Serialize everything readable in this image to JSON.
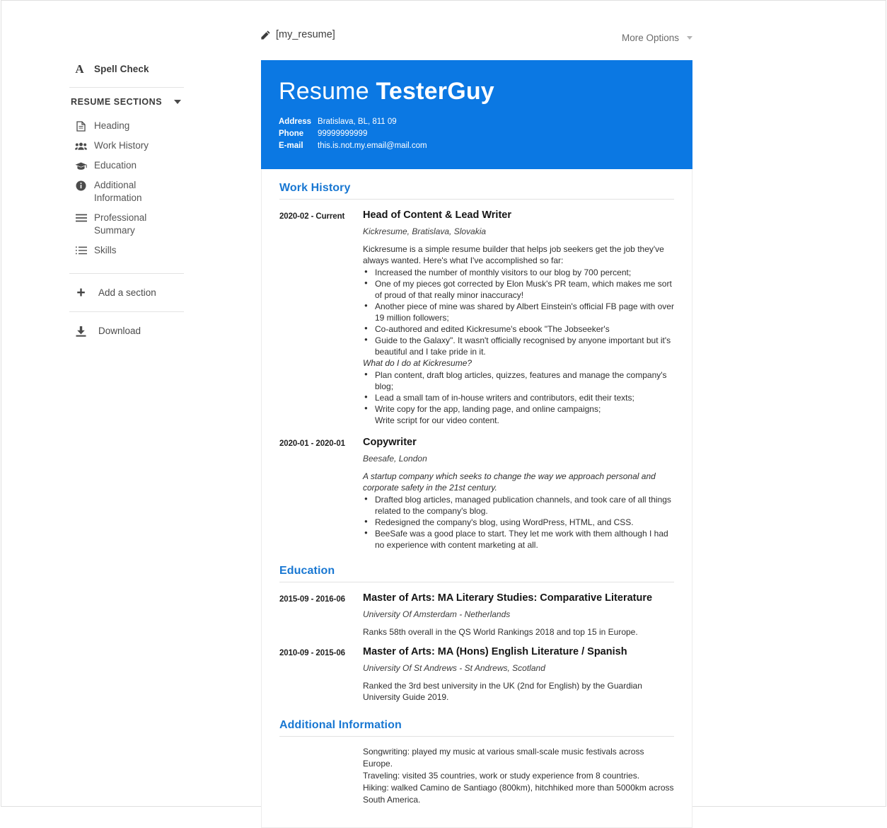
{
  "topbar": {
    "doc_name": "[my_resume]",
    "more_options": "More Options"
  },
  "sidebar": {
    "spell_check": "Spell Check",
    "sections_title": "RESUME SECTIONS",
    "items": [
      {
        "label": "Heading",
        "icon": "document-icon"
      },
      {
        "label": "Work History",
        "icon": "users-icon"
      },
      {
        "label": "Education",
        "icon": "graduation-cap-icon"
      },
      {
        "label": "Additional Information",
        "icon": "info-circle-icon"
      },
      {
        "label": "Professional Summary",
        "icon": "menu-lines-icon"
      },
      {
        "label": "Skills",
        "icon": "list-icon"
      }
    ],
    "add_section": "Add a section",
    "download": "Download"
  },
  "colors": {
    "header_blue": "#0b78e3",
    "heading_blue": "#1877d2"
  },
  "resume": {
    "first_name": "Resume",
    "last_name": "TesterGuy",
    "contact": [
      {
        "label": "Address",
        "value": "Bratislava, BL, 811 09"
      },
      {
        "label": "Phone",
        "value": "99999999999"
      },
      {
        "label": "E-mail",
        "value": "this.is.not.my.email@mail.com"
      }
    ],
    "sections": {
      "work_history": {
        "heading": "Work History",
        "entries": [
          {
            "date": "2020-02 - Current",
            "title": "Head of Content & Lead Writer",
            "subtitle": "Kickresume, Bratislava, Slovakia",
            "intro": "Kickresume is a simple resume builder that helps job seekers get the job they've always wanted. Here's what I've accomplished so far:",
            "bullets": [
              "Increased the number of monthly visitors to our blog by 700 percent;",
              "One of my pieces got corrected by Elon Musk's PR team, which makes me sort of proud of that really minor inaccuracy!",
              "Another piece of mine was shared by Albert Einstein's official FB page with over 19 million followers;",
              "Co-authored and edited Kickresume's ebook \"The Jobseeker's",
              "Guide to the Galaxy\". It wasn't officially recognised by anyone important but it's beautiful and I take pride in it."
            ],
            "mid_heading": "What do I do at Kickresume?",
            "bullets2": [
              "Plan content, draft blog articles, quizzes, features and manage the company's blog;",
              "Lead a small tam of in-house writers and contributors, edit their texts;",
              "Write copy for the app, landing page, and online campaigns;"
            ],
            "trailing_line": "Write script for our video content."
          },
          {
            "date": "2020-01 - 2020-01",
            "title": "Copywriter",
            "subtitle": "Beesafe, London",
            "intro_italic": "A startup company which seeks to change the way we approach personal and corporate safety in the 21st century.",
            "bullets": [
              "Drafted blog articles, managed publication channels, and took care of all things related to the company's blog.",
              "Redesigned the company's blog, using WordPress, HTML, and CSS.",
              "BeeSafe was a good place to start. They let me work with them although I had no experience with content marketing at all."
            ]
          }
        ]
      },
      "education": {
        "heading": "Education",
        "entries": [
          {
            "date": "2015-09 - 2016-06",
            "title": "Master of Arts: MA Literary Studies: Comparative Literature",
            "subtitle": "University Of Amsterdam - Netherlands",
            "description": "Ranks 58th overall in the QS World Rankings 2018 and top 15 in Europe."
          },
          {
            "date": "2010-09 - 2015-06",
            "title": "Master of Arts: MA (Hons) English Literature / Spanish",
            "subtitle": "University Of St Andrews - St Andrews, Scotland",
            "description": "Ranked the 3rd best university in the UK (2nd for English) by the Guardian University Guide 2019."
          }
        ]
      },
      "additional_information": {
        "heading": "Additional Information",
        "lines": [
          "Songwriting: played my music at various small-scale music festivals across Europe.",
          "Traveling: visited 35 countries, work or study experience from 8 countries.",
          "Hiking: walked Camino de Santiago (800km), hitchhiked more than 5000km across South America."
        ]
      }
    }
  }
}
